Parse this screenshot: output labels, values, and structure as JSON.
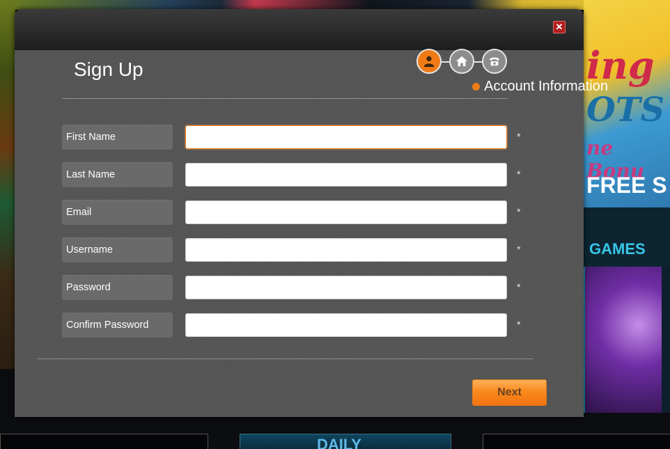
{
  "modal": {
    "title": "Sign Up",
    "close_glyph": "✕",
    "steps": [
      {
        "icon": "user-icon",
        "active": true
      },
      {
        "icon": "home-icon",
        "active": false
      },
      {
        "icon": "phone-icon",
        "active": false
      }
    ],
    "current_step_label": "Account Information",
    "accent_color": "#f07b16"
  },
  "form": {
    "required_marker": "*",
    "fields": [
      {
        "label": "First Name",
        "value": "",
        "focused": true
      },
      {
        "label": "Last Name",
        "value": ""
      },
      {
        "label": "Email",
        "value": ""
      },
      {
        "label": "Username",
        "value": ""
      },
      {
        "label": "Password",
        "value": ""
      },
      {
        "label": "Confirm Password",
        "value": ""
      }
    ],
    "next_label": "Next"
  },
  "background": {
    "banner_lines": [
      "ing",
      "OTS",
      "ne Bonu",
      "FREE S"
    ],
    "games_label": "GAMES",
    "bottom_label": "DAILY"
  }
}
